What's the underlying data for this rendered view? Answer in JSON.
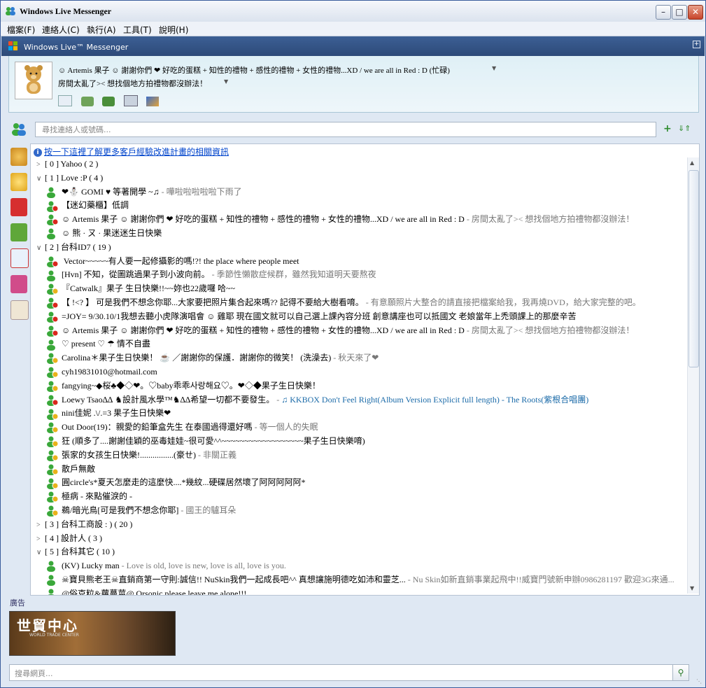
{
  "window": {
    "title": "Windows Live Messenger"
  },
  "menu": [
    "檔案(F)",
    "連絡人(C)",
    "執行(A)",
    "工具(T)",
    "說明(H)"
  ],
  "brand": "Windows Live™ Messenger",
  "profile": {
    "display_name": "☺ Artemis 果子 ☺ 謝謝你們 ❤ 好吃的蛋糕 + 知性的禮物 + 感性的禮物 + 女性的禮物...XD / we are all in Red : D  (忙碌)",
    "personal_message": "房間太亂了>< 想找個地方拍禮物都沒辦法！"
  },
  "search": {
    "placeholder": "尋找連絡人或號碼..."
  },
  "info_link": "按一下這裡了解更多客戶經驗改進計畫的相關資訊",
  "rows": [
    {
      "type": "group",
      "expanded": false,
      "text": "[ 0 ] Yahoo ( 2 )"
    },
    {
      "type": "group",
      "expanded": true,
      "text": "[ 1 ] Love :P ( 4 )"
    },
    {
      "type": "contact",
      "status": "online",
      "name": "❤⛄ GOMI ♥  等著開學 ~♫",
      "psm": " - 嘩啦啦啦啦啦下雨了"
    },
    {
      "type": "contact",
      "status": "busy",
      "name": "【迷幻藥櫃】低調",
      "psm": ""
    },
    {
      "type": "contact",
      "status": "busy",
      "name": "☺ Artemis 果子 ☺ 謝謝你們 ❤ 好吃的蛋糕 + 知性的禮物 + 感性的禮物 + 女性的禮物...XD / we are all in Red : D",
      "psm": " - 房間太亂了>< 想找個地方拍禮物都沒辦法！"
    },
    {
      "type": "contact",
      "status": "online",
      "name": "☺ 熊 · ㄡ · 果迷迷生日快樂",
      "psm": ""
    },
    {
      "type": "group",
      "expanded": true,
      "text": "[ 2 ] 台科ID7 ( 19 )"
    },
    {
      "type": "contact",
      "status": "busy",
      "name": "     Vector~~~~~有人要一起修攝影的嗎!?!        the place where people meet",
      "psm": ""
    },
    {
      "type": "contact",
      "status": "online",
      "name": "[Hvn] 不知，從圖跳過果子到小波向前。",
      "psm": " - 季節性懶散症候群，雖然我知道明天要熬夜"
    },
    {
      "type": "contact",
      "status": "away",
      "name": "『Catwalk』果子 生日快樂!!~~妳也22歲囉  哈~~",
      "psm": ""
    },
    {
      "type": "contact",
      "status": "busy",
      "name": "【  !<?  】 可是我們不想念你耶...大家要把照片集合起來嗎??  記得不要給大樹看唷。",
      "psm": " - 有意願照片大整合的請直接把檔案給我，我再燒DVD，給大家完整的吧。"
    },
    {
      "type": "contact",
      "status": "busy",
      "name": "=JOY= 9/30.10/1我想去聽小虎隊演唱會 ☺ 雞耶 現在國文就可以自己選上課內容分班  創意講座也可以抵國文  老娘當年上禿頭課上的那麼辛苦",
      "psm": ""
    },
    {
      "type": "contact",
      "status": "busy",
      "name": "☺ Artemis 果子 ☺ 謝謝你們 ❤ 好吃的蛋糕 + 知性的禮物 + 感性的禮物 + 女性的禮物...XD / we are all in Red : D",
      "psm": " - 房間太亂了>< 想找個地方拍禮物都沒辦法！"
    },
    {
      "type": "contact",
      "status": "online",
      "name": "♡  present ♡ ☂  情不自盡",
      "psm": ""
    },
    {
      "type": "contact",
      "status": "away",
      "name": "Carolina＊果子生日快樂！ ☕ ／謝謝你的保護．謝謝你的微笑！ (洗澡去)",
      "psm": " - 秋天來了❤"
    },
    {
      "type": "contact",
      "status": "away",
      "name": "cyh19831010@hotmail.com",
      "psm": ""
    },
    {
      "type": "contact",
      "status": "away",
      "name": "fangying~◆桜♣◆◇❤。♡baby乖乖사랑해요♡。❤◇◆果子生日快樂！",
      "psm": ""
    },
    {
      "type": "contact",
      "status": "busy",
      "name": "Loewy Tsao∆∆ ♞設計風水學™♞∆∆希望一切都不要發生。",
      "psm": " - ",
      "music": "♫ KKBOX Don't Feel Right(Album Version Explicit full length) - The Roots(紫根合唱團)"
    },
    {
      "type": "contact",
      "status": "away",
      "name": "nini佳妮 .\\/.=3  果子生日快樂❤",
      "psm": ""
    },
    {
      "type": "contact",
      "status": "away",
      "name": "Out Door(19)：親愛的鉛筆盒先生    在泰國過得還好嗎",
      "psm": " - 等一個人的失眠"
    },
    {
      "type": "contact",
      "status": "away",
      "name": "狂 (順多了....謝謝佳穎的巫毒娃娃~很可愛^^~~~~~~~~~~~~~~~~~~果子生日快樂唷)",
      "psm": ""
    },
    {
      "type": "contact",
      "status": "away",
      "name": "張家的女孩生日快樂!................(豪ㄝ)",
      "psm": " - 非關正義"
    },
    {
      "type": "contact",
      "status": "away",
      "name": "散戶無敵",
      "psm": ""
    },
    {
      "type": "contact",
      "status": "away",
      "name": "圓circle's*夏天怎麼走的這麼快....*幾紋...硬碟居然壞了阿阿阿阿阿*",
      "psm": ""
    },
    {
      "type": "contact",
      "status": "away",
      "name": "極病  - 來點催淚的 -",
      "psm": ""
    },
    {
      "type": "contact",
      "status": "away",
      "name": "鵜/暗光鳥[可是我們不想念你耶]",
      "psm": " - 國王的驢耳朵"
    },
    {
      "type": "group",
      "expanded": false,
      "text": "[ 3 ] 台科工商設 : ) ( 20 )"
    },
    {
      "type": "group",
      "expanded": false,
      "text": "[ 4 ] 設計人 ( 3 )"
    },
    {
      "type": "group",
      "expanded": true,
      "text": "[ 5 ] 台科其它 ( 10 )"
    },
    {
      "type": "contact",
      "status": "online",
      "name": "(KV)  Lucky man",
      "psm": " - Love is old, love is new, love is all, love is you."
    },
    {
      "type": "contact",
      "status": "online",
      "name": "☠寶貝熊老王☠直銷商第一守則:誠信!! NuSkin我們一起成長吧^^ 真想讓施明德吃如沛和靈芝...",
      "psm": " - Nu Skin如新直銷事業起飛中!!威寶門號新申辦0986281197 歡迎3G來通..."
    },
    {
      "type": "contact",
      "status": "online",
      "name": "@俗克粒&蘿蔓莖@  Orsonic  please leave me alone!!!",
      "psm": ""
    }
  ],
  "ad": {
    "label": "廣告",
    "banner_title": "世貿中心",
    "banner_sub": "WORLD TRADE CENTER"
  },
  "web_search": {
    "placeholder": "搜尋網頁..."
  },
  "colors": {
    "online": "#3aa83a",
    "busy": "#d9261c",
    "away": "#e8b21a",
    "link": "#0044cc"
  }
}
